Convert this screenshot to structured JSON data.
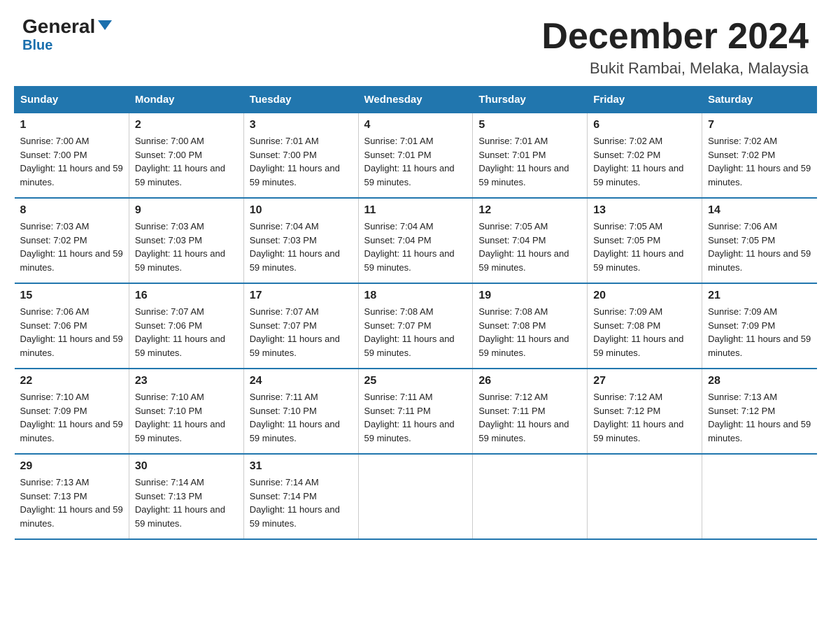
{
  "header": {
    "logo_general": "General",
    "logo_blue": "Blue",
    "month_title": "December 2024",
    "location": "Bukit Rambai, Melaka, Malaysia"
  },
  "days_of_week": [
    "Sunday",
    "Monday",
    "Tuesday",
    "Wednesday",
    "Thursday",
    "Friday",
    "Saturday"
  ],
  "weeks": [
    [
      {
        "day": "1",
        "sunrise": "7:00 AM",
        "sunset": "7:00 PM",
        "daylight": "11 hours and 59 minutes."
      },
      {
        "day": "2",
        "sunrise": "7:00 AM",
        "sunset": "7:00 PM",
        "daylight": "11 hours and 59 minutes."
      },
      {
        "day": "3",
        "sunrise": "7:01 AM",
        "sunset": "7:00 PM",
        "daylight": "11 hours and 59 minutes."
      },
      {
        "day": "4",
        "sunrise": "7:01 AM",
        "sunset": "7:01 PM",
        "daylight": "11 hours and 59 minutes."
      },
      {
        "day": "5",
        "sunrise": "7:01 AM",
        "sunset": "7:01 PM",
        "daylight": "11 hours and 59 minutes."
      },
      {
        "day": "6",
        "sunrise": "7:02 AM",
        "sunset": "7:02 PM",
        "daylight": "11 hours and 59 minutes."
      },
      {
        "day": "7",
        "sunrise": "7:02 AM",
        "sunset": "7:02 PM",
        "daylight": "11 hours and 59 minutes."
      }
    ],
    [
      {
        "day": "8",
        "sunrise": "7:03 AM",
        "sunset": "7:02 PM",
        "daylight": "11 hours and 59 minutes."
      },
      {
        "day": "9",
        "sunrise": "7:03 AM",
        "sunset": "7:03 PM",
        "daylight": "11 hours and 59 minutes."
      },
      {
        "day": "10",
        "sunrise": "7:04 AM",
        "sunset": "7:03 PM",
        "daylight": "11 hours and 59 minutes."
      },
      {
        "day": "11",
        "sunrise": "7:04 AM",
        "sunset": "7:04 PM",
        "daylight": "11 hours and 59 minutes."
      },
      {
        "day": "12",
        "sunrise": "7:05 AM",
        "sunset": "7:04 PM",
        "daylight": "11 hours and 59 minutes."
      },
      {
        "day": "13",
        "sunrise": "7:05 AM",
        "sunset": "7:05 PM",
        "daylight": "11 hours and 59 minutes."
      },
      {
        "day": "14",
        "sunrise": "7:06 AM",
        "sunset": "7:05 PM",
        "daylight": "11 hours and 59 minutes."
      }
    ],
    [
      {
        "day": "15",
        "sunrise": "7:06 AM",
        "sunset": "7:06 PM",
        "daylight": "11 hours and 59 minutes."
      },
      {
        "day": "16",
        "sunrise": "7:07 AM",
        "sunset": "7:06 PM",
        "daylight": "11 hours and 59 minutes."
      },
      {
        "day": "17",
        "sunrise": "7:07 AM",
        "sunset": "7:07 PM",
        "daylight": "11 hours and 59 minutes."
      },
      {
        "day": "18",
        "sunrise": "7:08 AM",
        "sunset": "7:07 PM",
        "daylight": "11 hours and 59 minutes."
      },
      {
        "day": "19",
        "sunrise": "7:08 AM",
        "sunset": "7:08 PM",
        "daylight": "11 hours and 59 minutes."
      },
      {
        "day": "20",
        "sunrise": "7:09 AM",
        "sunset": "7:08 PM",
        "daylight": "11 hours and 59 minutes."
      },
      {
        "day": "21",
        "sunrise": "7:09 AM",
        "sunset": "7:09 PM",
        "daylight": "11 hours and 59 minutes."
      }
    ],
    [
      {
        "day": "22",
        "sunrise": "7:10 AM",
        "sunset": "7:09 PM",
        "daylight": "11 hours and 59 minutes."
      },
      {
        "day": "23",
        "sunrise": "7:10 AM",
        "sunset": "7:10 PM",
        "daylight": "11 hours and 59 minutes."
      },
      {
        "day": "24",
        "sunrise": "7:11 AM",
        "sunset": "7:10 PM",
        "daylight": "11 hours and 59 minutes."
      },
      {
        "day": "25",
        "sunrise": "7:11 AM",
        "sunset": "7:11 PM",
        "daylight": "11 hours and 59 minutes."
      },
      {
        "day": "26",
        "sunrise": "7:12 AM",
        "sunset": "7:11 PM",
        "daylight": "11 hours and 59 minutes."
      },
      {
        "day": "27",
        "sunrise": "7:12 AM",
        "sunset": "7:12 PM",
        "daylight": "11 hours and 59 minutes."
      },
      {
        "day": "28",
        "sunrise": "7:13 AM",
        "sunset": "7:12 PM",
        "daylight": "11 hours and 59 minutes."
      }
    ],
    [
      {
        "day": "29",
        "sunrise": "7:13 AM",
        "sunset": "7:13 PM",
        "daylight": "11 hours and 59 minutes."
      },
      {
        "day": "30",
        "sunrise": "7:14 AM",
        "sunset": "7:13 PM",
        "daylight": "11 hours and 59 minutes."
      },
      {
        "day": "31",
        "sunrise": "7:14 AM",
        "sunset": "7:14 PM",
        "daylight": "11 hours and 59 minutes."
      },
      null,
      null,
      null,
      null
    ]
  ],
  "labels": {
    "sunrise": "Sunrise:",
    "sunset": "Sunset:",
    "daylight": "Daylight:"
  }
}
